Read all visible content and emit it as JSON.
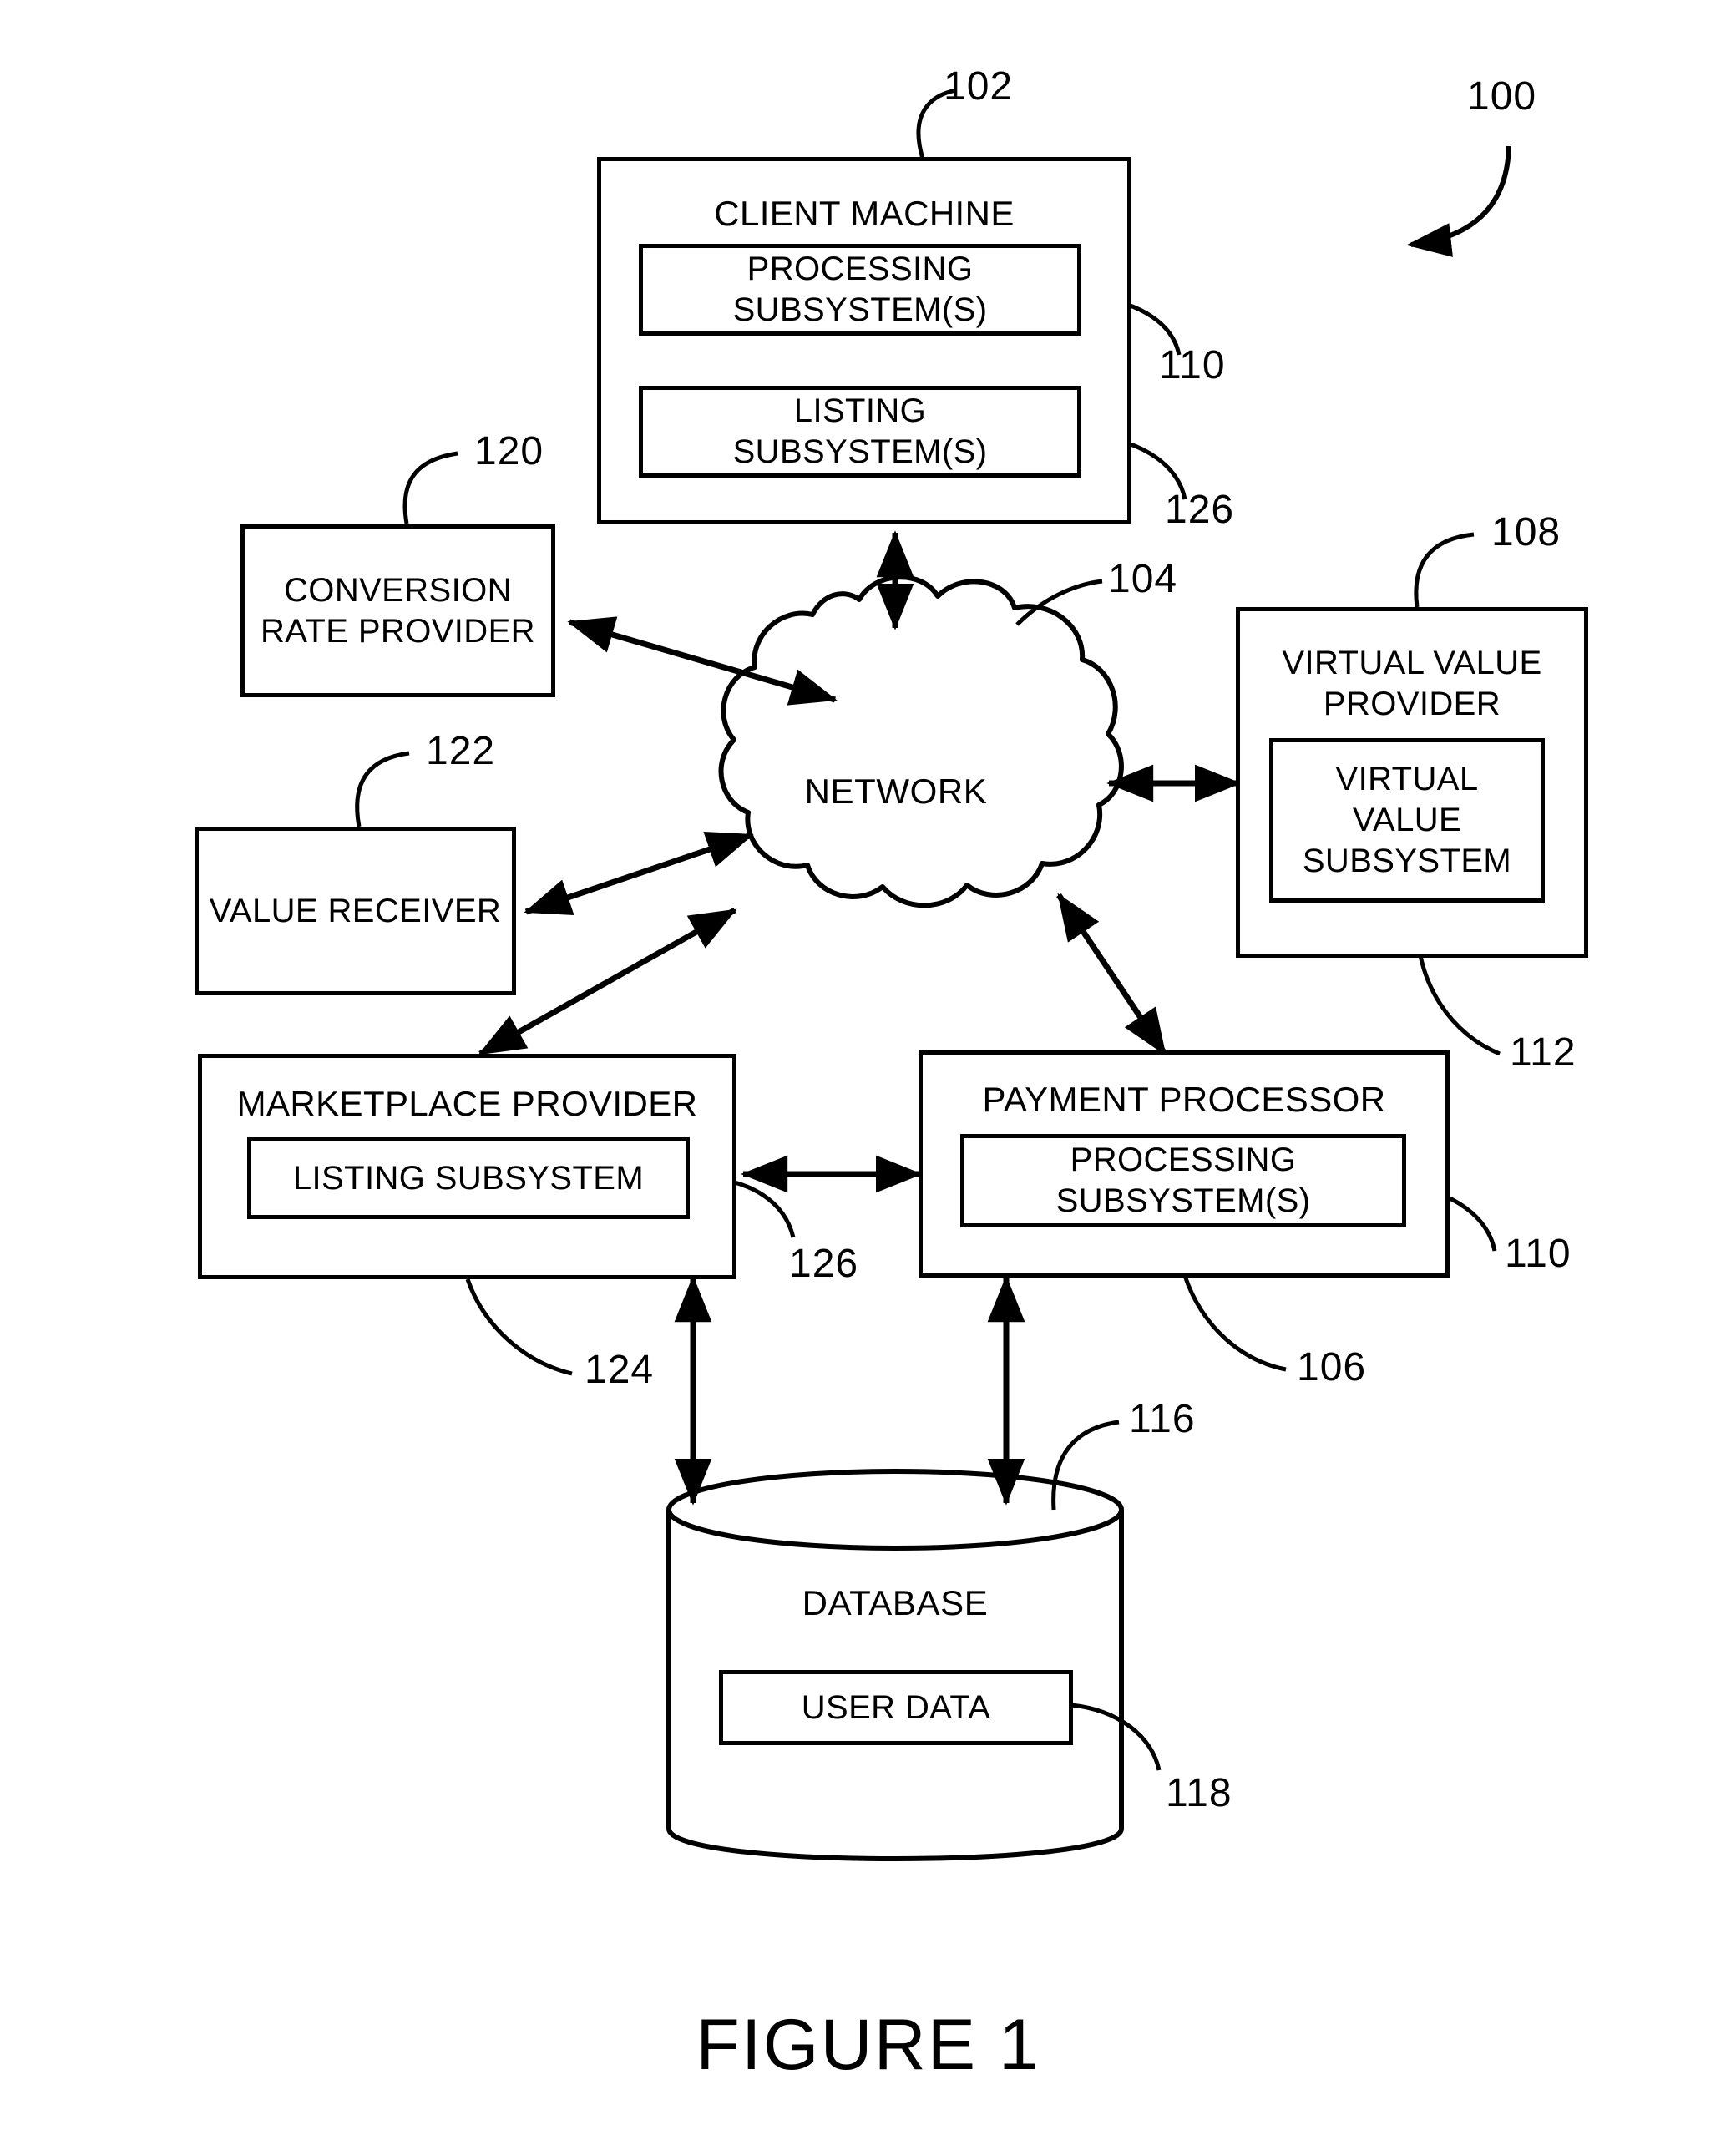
{
  "figure": {
    "caption": "FIGURE 1",
    "system_ref": "100"
  },
  "nodes": {
    "client_machine": {
      "title": "CLIENT MACHINE",
      "ref": "102",
      "subsystems": [
        {
          "title_line1": "PROCESSING",
          "title_line2": "SUBSYSTEM(S)",
          "ref": "110"
        },
        {
          "title_line1": "LISTING",
          "title_line2": "SUBSYSTEM(S)",
          "ref": "126"
        }
      ]
    },
    "conversion_rate_provider": {
      "title_line1": "CONVERSION",
      "title_line2": "RATE PROVIDER",
      "ref": "120"
    },
    "value_receiver": {
      "title": "VALUE RECEIVER",
      "ref": "122"
    },
    "network": {
      "title": "NETWORK",
      "ref": "104"
    },
    "virtual_value_provider": {
      "title_line1": "VIRTUAL VALUE",
      "title_line2": "PROVIDER",
      "ref": "108",
      "subsystem": {
        "title_line1": "VIRTUAL",
        "title_line2": "VALUE",
        "title_line3": "SUBSYSTEM",
        "ref": "112"
      }
    },
    "marketplace_provider": {
      "title": "MARKETPLACE PROVIDER",
      "ref": "124",
      "subsystem": {
        "title": "LISTING SUBSYSTEM",
        "ref": "126"
      }
    },
    "payment_processor": {
      "title": "PAYMENT PROCESSOR",
      "ref": "106",
      "subsystem": {
        "title_line1": "PROCESSING",
        "title_line2": "SUBSYSTEM(S)",
        "ref": "110"
      }
    },
    "database": {
      "title": "DATABASE",
      "ref": "116",
      "subsystem": {
        "title": "USER DATA",
        "ref": "118"
      }
    }
  },
  "style": {
    "ink": "#000000",
    "paper": "#ffffff"
  }
}
